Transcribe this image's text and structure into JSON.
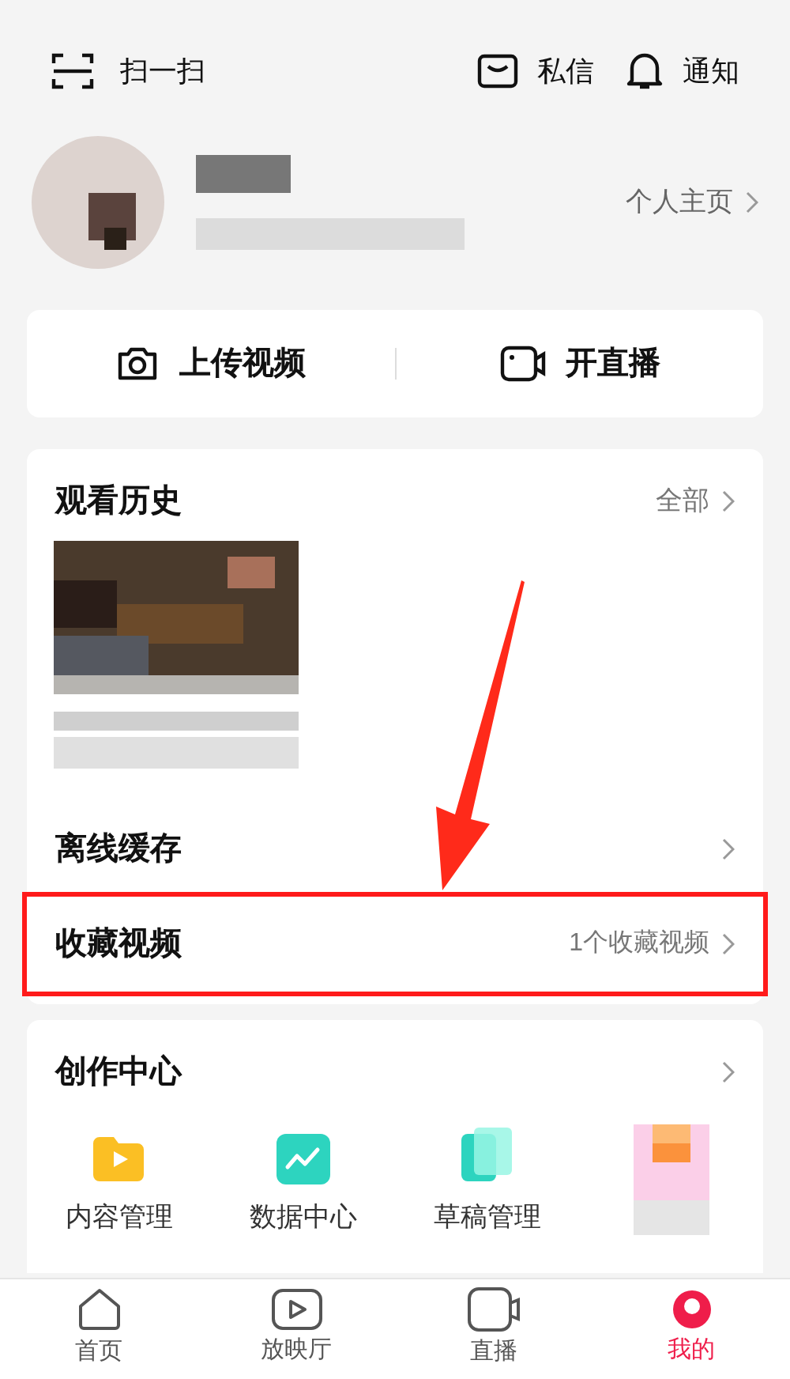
{
  "header": {
    "scan": "扫一扫",
    "actions": [
      {
        "kind": "mail",
        "label": "私信"
      },
      {
        "kind": "bell",
        "label": "通知"
      }
    ]
  },
  "profile": {
    "homepage_link": "个人主页"
  },
  "quick_actions": [
    {
      "kind": "camera",
      "label": "上传视频"
    },
    {
      "kind": "live",
      "label": "开直播"
    }
  ],
  "history": {
    "title": "观看历史",
    "more": "全部"
  },
  "rows": [
    {
      "title": "离线缓存",
      "highlighted": false
    },
    {
      "title": "收藏视频",
      "detail": "1个收藏视频",
      "highlighted": true
    }
  ],
  "creation": {
    "title": "创作中心",
    "tools": [
      {
        "kind": "content",
        "label": "内容管理"
      },
      {
        "kind": "data",
        "label": "数据中心"
      },
      {
        "kind": "draft",
        "label": "草稿管理"
      },
      {
        "kind": "blurred"
      }
    ]
  },
  "nav": [
    {
      "kind": "home",
      "label": "首页",
      "selected": false
    },
    {
      "kind": "play",
      "label": "放映厅",
      "selected": false
    },
    {
      "kind": "live",
      "label": "直播",
      "selected": false
    },
    {
      "kind": "me",
      "label": "我的",
      "selected": true
    }
  ]
}
